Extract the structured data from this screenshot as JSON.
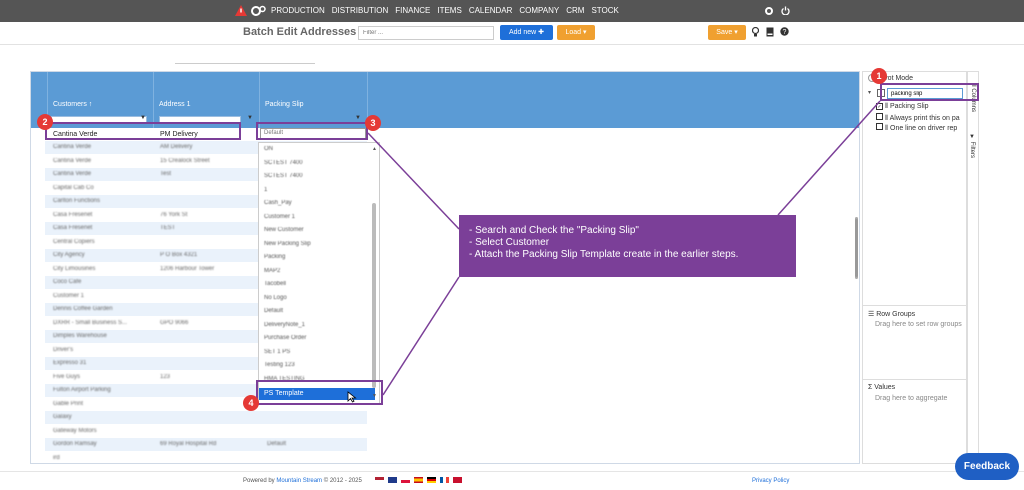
{
  "topnav": {
    "items": [
      "PRODUCTION",
      "DISTRIBUTION",
      "FINANCE",
      "ITEMS",
      "CALENDAR",
      "COMPANY",
      "CRM",
      "STOCK"
    ]
  },
  "toolbar": {
    "title": "Batch Edit Addresses",
    "filter_placeholder": "Filter ...",
    "add_new": "Add new",
    "load": "Load",
    "save": "Save"
  },
  "grid": {
    "columns": [
      "Customers",
      "Address 1",
      "Packing Slip"
    ],
    "selected_row": {
      "customer": "Cantina Verde",
      "address": "PM Delivery",
      "packing_slip": "Default"
    },
    "rows": [
      [
        "Cantina Verde",
        "AM Delivery",
        ""
      ],
      [
        "Cantina Verde",
        "15 Crealock Street",
        ""
      ],
      [
        "Cantina Verde",
        "Test",
        ""
      ],
      [
        "Capital Cab Co",
        "",
        ""
      ],
      [
        "Carlton Functions",
        "",
        ""
      ],
      [
        "Casa Fresenet",
        "76 York St",
        ""
      ],
      [
        "Casa Fresenet",
        "TEST",
        ""
      ],
      [
        "Central Copiers",
        "",
        ""
      ],
      [
        "City Agency",
        "P O Box 4321",
        ""
      ],
      [
        "City Limousines",
        "1206 Harbour Tower",
        ""
      ],
      [
        "Coco Cafe",
        "",
        ""
      ],
      [
        "Customer 1",
        "",
        ""
      ],
      [
        "Dennis Coffee Garden",
        "",
        ""
      ],
      [
        "DXRR - Small Business S...",
        "GPO 9066",
        ""
      ],
      [
        "Dimples Warehouse",
        "",
        ""
      ],
      [
        "Driver's",
        "",
        ""
      ],
      [
        "Expresso 31",
        "",
        ""
      ],
      [
        "Five Guys",
        "123",
        ""
      ],
      [
        "Fulton Airport Parking",
        "",
        ""
      ],
      [
        "Gable Print",
        "",
        ""
      ],
      [
        "Galaxy",
        "",
        ""
      ],
      [
        "Gateway Motors",
        "",
        ""
      ],
      [
        "Gordon Ramsay",
        "69 Royal Hospital Rd",
        "Default"
      ],
      [
        "ird",
        "",
        ""
      ]
    ]
  },
  "dropdown": {
    "options": [
      "ON",
      "SCTEST 7400",
      "SCTEST 7400",
      "1",
      "Cash_Pay",
      "Customer 1",
      "New Customer",
      "New Packing Slip",
      "Packing",
      "MAP2",
      "Tacobell",
      "No Logo",
      "Default",
      "DeliveryNote_1",
      "Purchase Order",
      "SET 1 PS",
      "Testing 123",
      "HMA TESTING",
      "Testing 1234"
    ],
    "selected": "PS Template"
  },
  "sidebar": {
    "pivot_mode": "Pivot Mode",
    "search_value": "packing slip",
    "columns_tab": "Columns",
    "filters_tab": "Filters",
    "items": [
      "Packing Slip",
      "Always print this on pa",
      "One line on driver rep"
    ],
    "row_groups_title": "Row Groups",
    "row_groups_hint": "Drag here to set row groups",
    "values_title": "Values",
    "values_hint": "Drag here to aggregate"
  },
  "annotation": {
    "lines": [
      "- Search and Check the \"Packing Slip\"",
      "- Select Customer",
      "- Attach the Packing Slip Template create in the earlier steps."
    ],
    "steps": [
      "1",
      "2",
      "3",
      "4"
    ]
  },
  "footer": {
    "powered_prefix": "Powered by",
    "brand": "Mountain Stream",
    "powered_suffix": "© 2012 - 2025",
    "privacy": "Privacy Policy"
  },
  "feedback_label": "Feedback",
  "colors": {
    "topbar": "#555555",
    "grid_header": "#5b9bd5",
    "add_new": "#1e6fd9",
    "load": "#f0a030",
    "save": "#f0a030",
    "annotation": "#7b3f98",
    "badge": "#e53935",
    "feedback": "#1f5fc4"
  }
}
